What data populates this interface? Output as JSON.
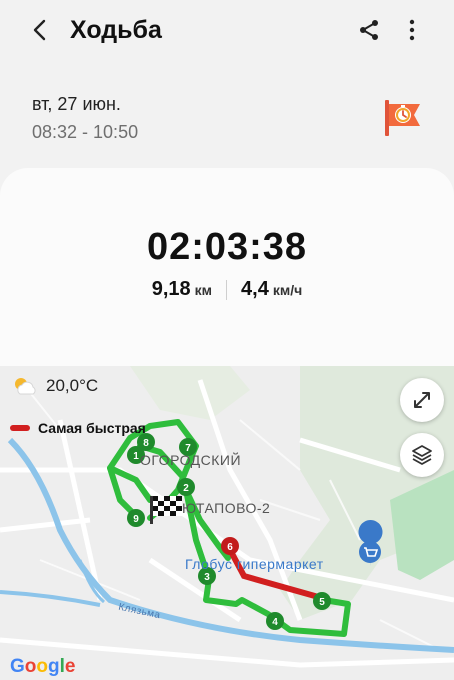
{
  "header": {
    "title": "Ходьба",
    "back_icon": "arrow-left-icon",
    "share_icon": "share-icon",
    "more_icon": "more-vertical-icon"
  },
  "workout": {
    "date": "вт, 27 июн.",
    "time_range": "08:32 - 10:50",
    "flag_icon": "stopwatch-flag-icon",
    "duration": "02:03:38",
    "distance_value": "9,18",
    "distance_unit": "км",
    "speed_value": "4,4",
    "speed_unit": "км/ч"
  },
  "map": {
    "weather_icon": "partly-cloudy-icon",
    "temperature": "20,0°C",
    "legend_fastest": "Самая быстрая",
    "labels": {
      "district": "ОГОРОДСКИЙ",
      "neighborhood": "ЮТАПОВО-2",
      "store": "Глобус гипермаркет",
      "river": "Клязьма"
    },
    "markers": [
      "1",
      "2",
      "3",
      "4",
      "5",
      "6",
      "7",
      "8",
      "9"
    ],
    "google": "Google",
    "colors": {
      "route": "#2fbd3c",
      "fastest": "#d11f1f",
      "water": "#8cc4ea",
      "park": "#b9e2c0"
    }
  }
}
